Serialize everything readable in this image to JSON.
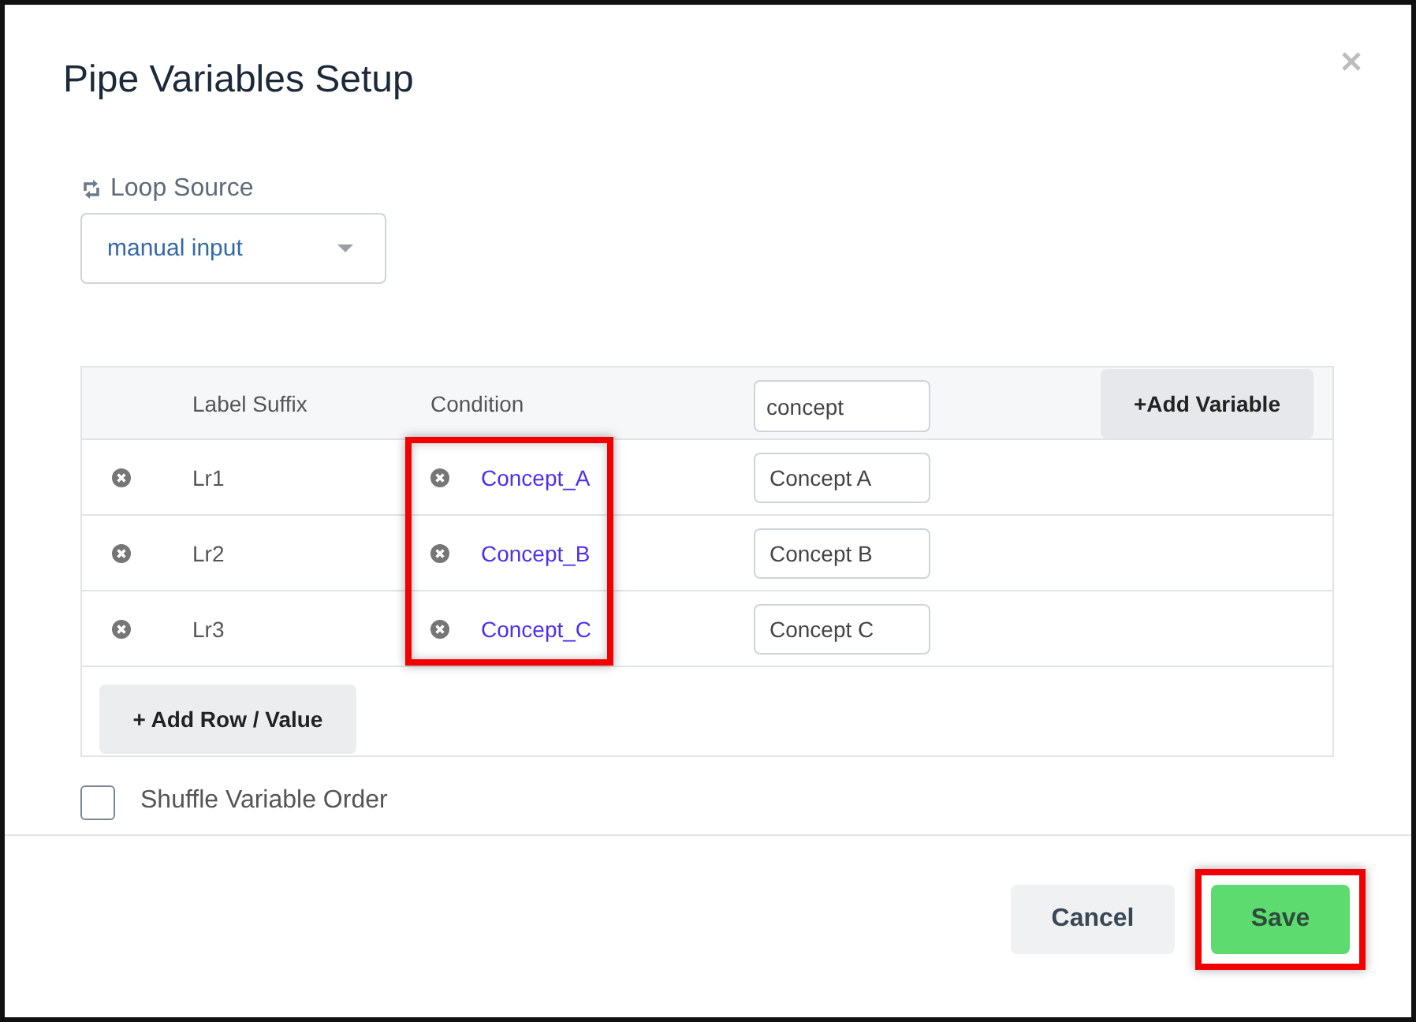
{
  "dialog": {
    "title": "Pipe Variables Setup"
  },
  "loop_source": {
    "label": "Loop Source",
    "value": "manual input"
  },
  "table": {
    "columns": [
      "Label Suffix",
      "Condition"
    ],
    "variable_input": {
      "value": "concept"
    },
    "add_variable_button": "+Add Variable",
    "condition_highlighted": true,
    "rows": [
      {
        "label_suffix": "Lr1",
        "condition": "Concept_A",
        "value": "Concept A"
      },
      {
        "label_suffix": "Lr2",
        "condition": "Concept_B",
        "value": "Concept B"
      },
      {
        "label_suffix": "Lr3",
        "condition": "Concept_C",
        "value": "Concept C"
      }
    ],
    "add_row_button": "+ Add Row / Value"
  },
  "shuffle": {
    "label": "Shuffle Variable Order",
    "checked": false
  },
  "buttons": [
    {
      "label": "Cancel",
      "kind": "secondary",
      "highlighted": false
    },
    {
      "label": "Save",
      "kind": "primary",
      "highlighted": true
    }
  ]
}
